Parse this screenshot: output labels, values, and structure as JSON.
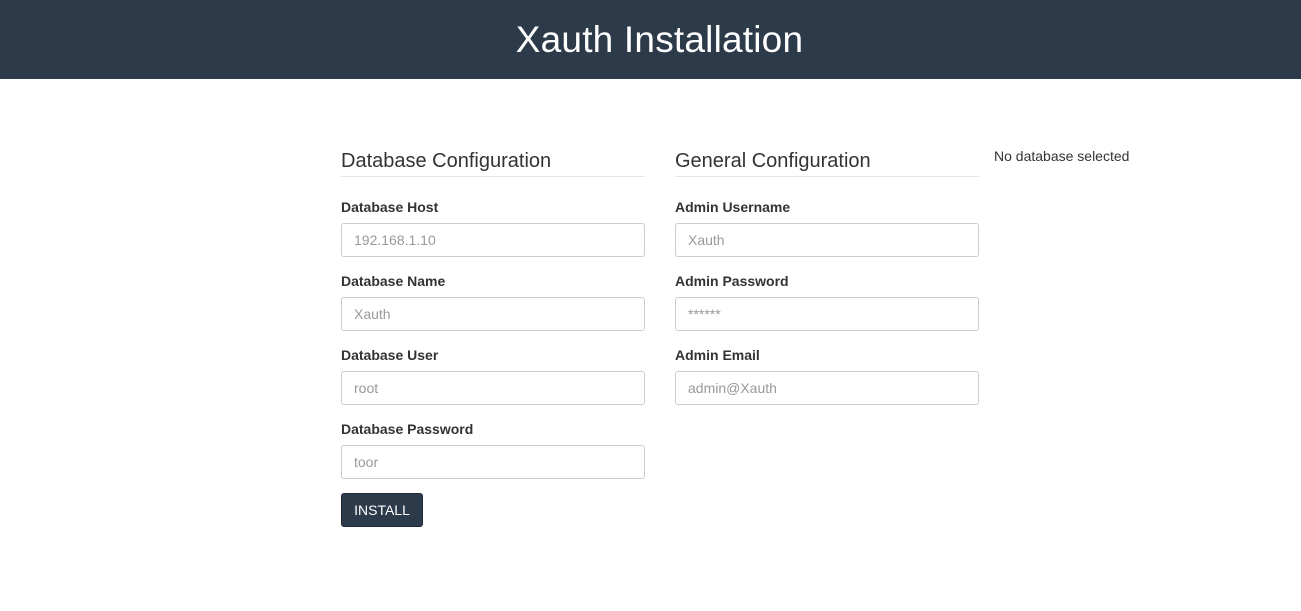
{
  "header": {
    "title": "Xauth Installation"
  },
  "database": {
    "heading": "Database Configuration",
    "fields": [
      {
        "label": "Database Host",
        "placeholder": "192.168.1.10"
      },
      {
        "label": "Database Name",
        "placeholder": "Xauth"
      },
      {
        "label": "Database User",
        "placeholder": "root"
      },
      {
        "label": "Database Password",
        "placeholder": "toor"
      }
    ],
    "install_label": "INSTALL"
  },
  "general": {
    "heading": "General Configuration",
    "fields": [
      {
        "label": "Admin Username",
        "placeholder": "Xauth"
      },
      {
        "label": "Admin Password",
        "placeholder": "******"
      },
      {
        "label": "Admin Email",
        "placeholder": "admin@Xauth"
      }
    ]
  },
  "status": {
    "text": "No database selected"
  },
  "colors": {
    "header_bg": "#2c3a4a",
    "button_bg": "#2c3a4a"
  }
}
